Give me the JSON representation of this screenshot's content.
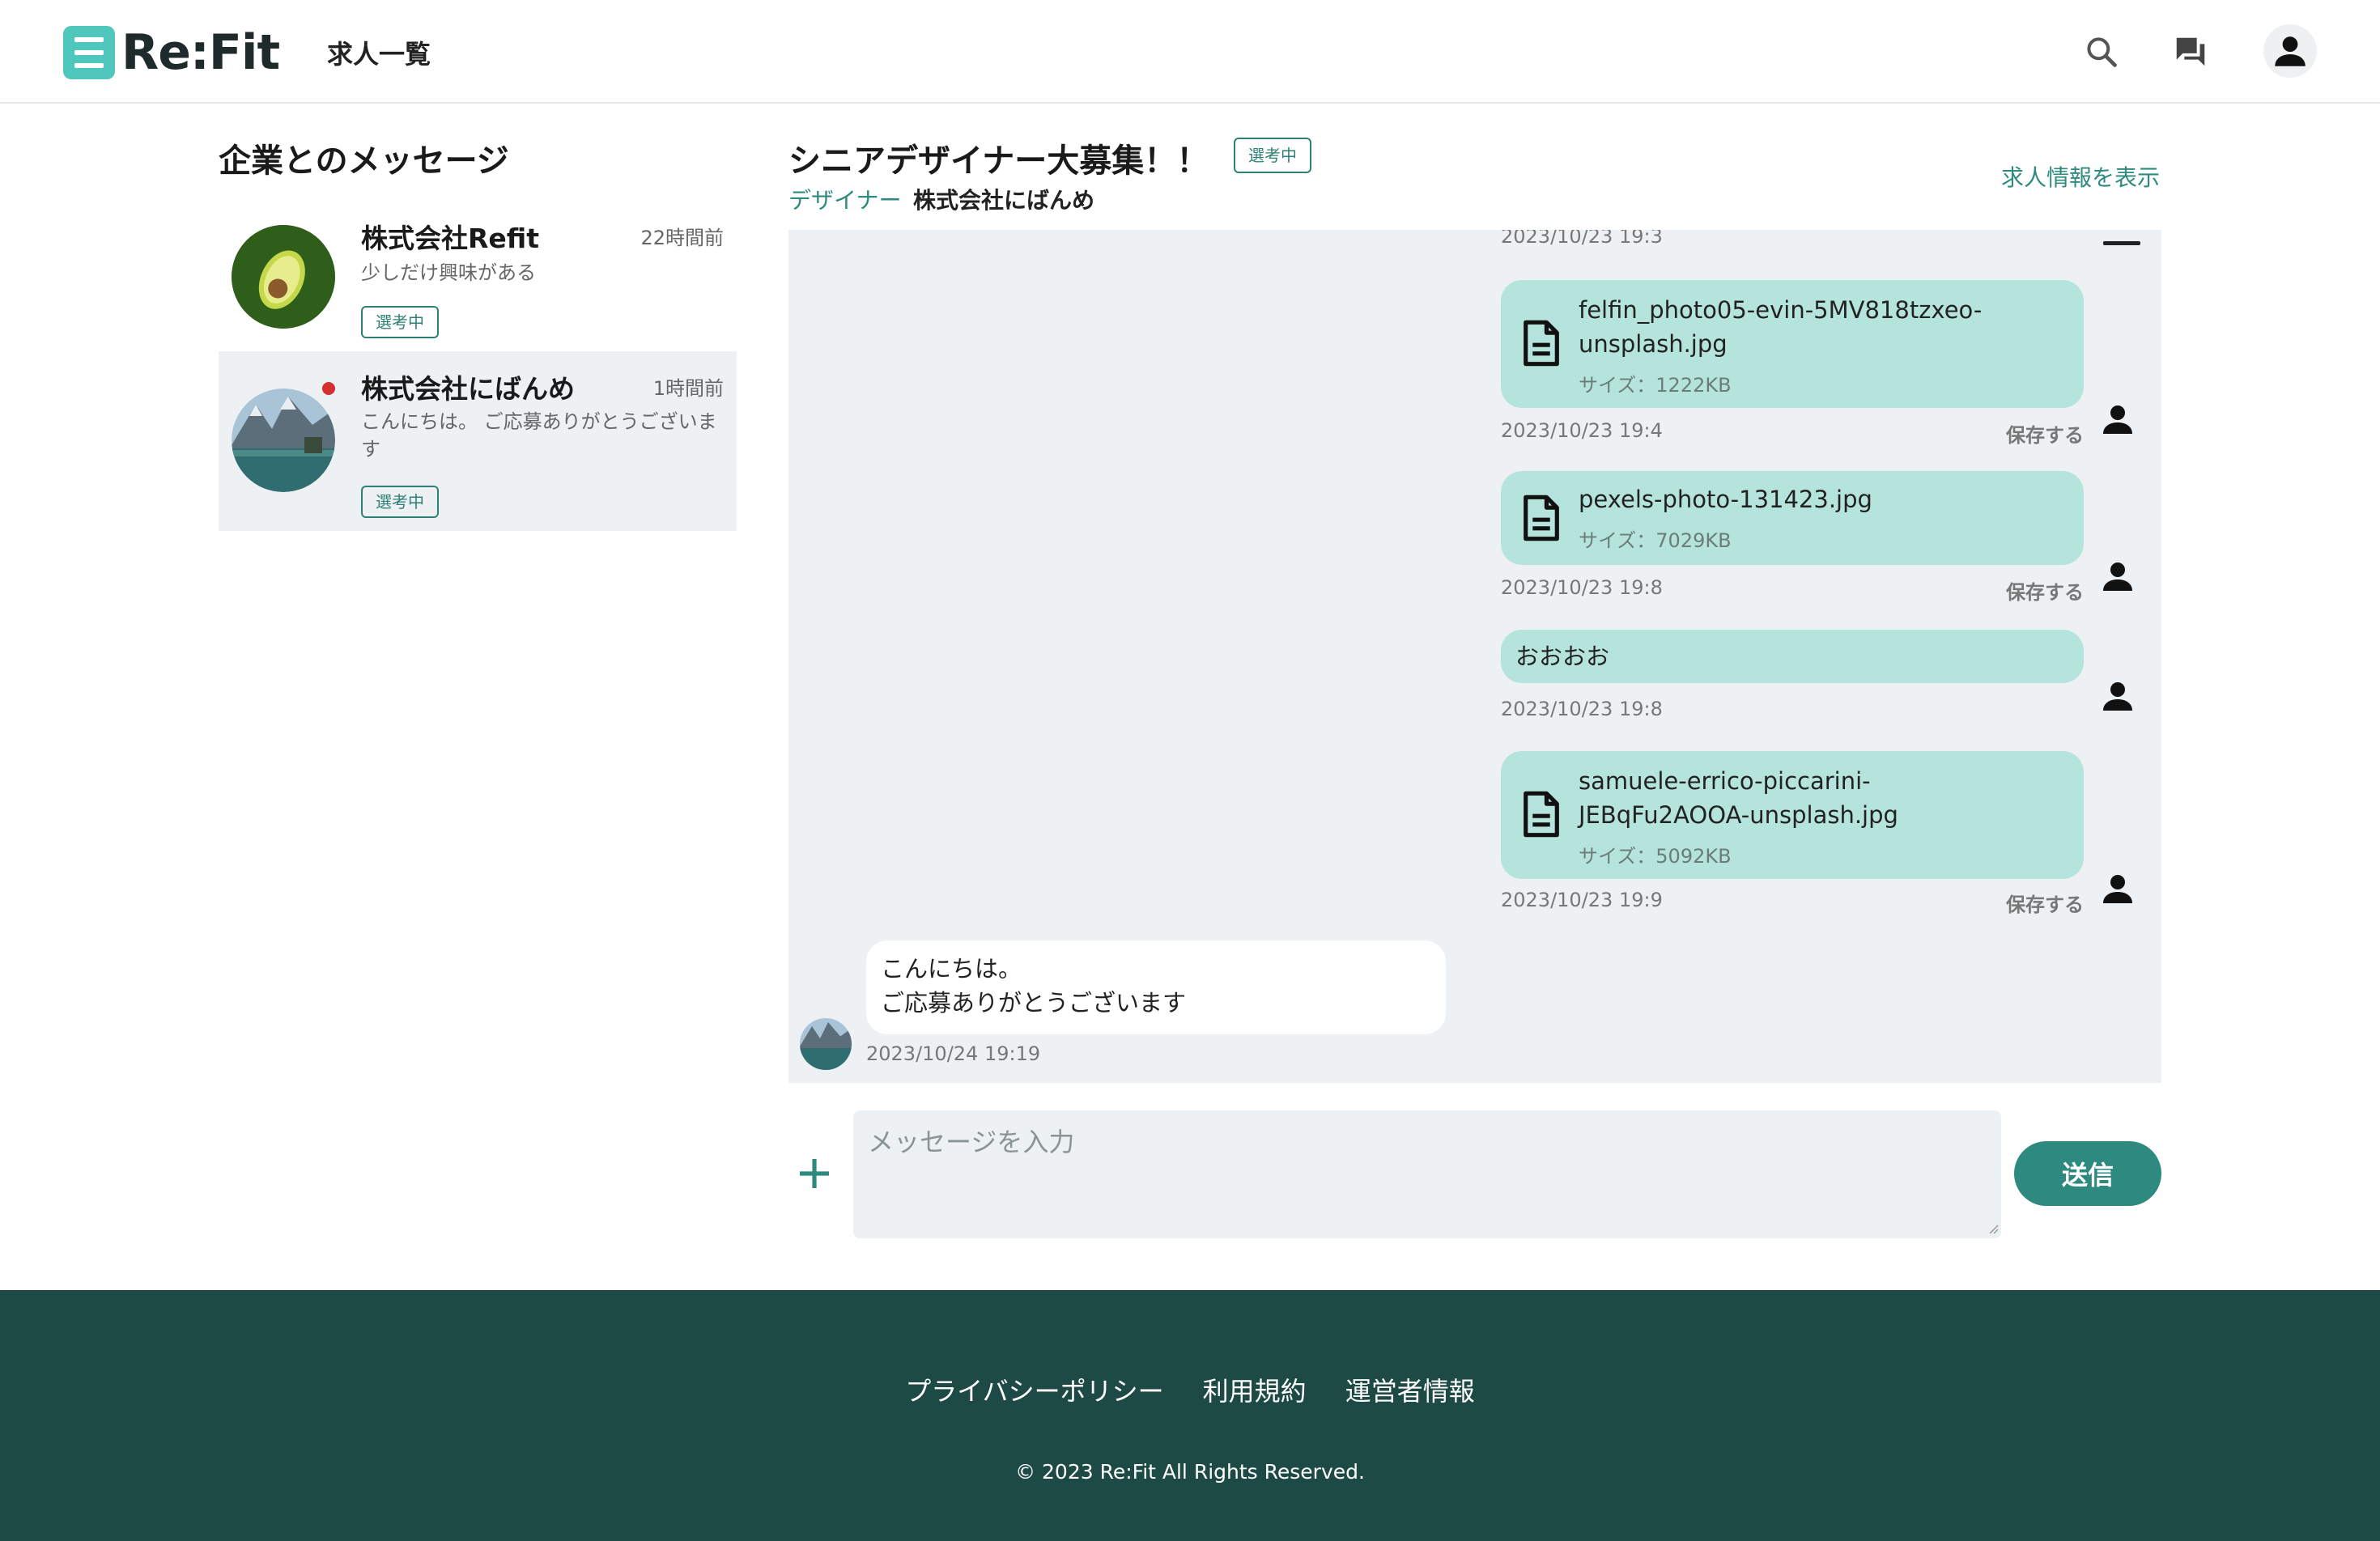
{
  "header": {
    "logo_text": "Re:Fit",
    "nav_jobs": "求人一覧",
    "icons": [
      "search-icon",
      "chat-icon",
      "account-icon"
    ]
  },
  "sidebar": {
    "title": "企業とのメッセージ",
    "conversations": [
      {
        "company": "株式会社Refit",
        "time": "22時間前",
        "preview": "少しだけ興味がある",
        "status": "選考中",
        "unread": false,
        "active": false
      },
      {
        "company": "株式会社にばんめ",
        "time": "1時間前",
        "preview": "こんにちは。 ご応募ありがとうございます",
        "status": "選考中",
        "unread": true,
        "active": true
      }
    ]
  },
  "chat_header": {
    "job_title": "シニアデザイナー大募集！！",
    "status": "選考中",
    "category": "デザイナー",
    "company": "株式会社にばんめ",
    "view_job_link": "求人情報を表示"
  },
  "messages": {
    "cut_time": "2023/10/23 19:3",
    "items": [
      {
        "type": "file",
        "name": "felfin_photo05-evin-5MV818tzxeo-unsplash.jpg",
        "size": "サイズ：1222KB",
        "time": "2023/10/23 19:4",
        "save": "保存する"
      },
      {
        "type": "file",
        "name": "pexels-photo-131423.jpg",
        "size": "サイズ：7029KB",
        "time": "2023/10/23 19:8",
        "save": "保存する"
      },
      {
        "type": "text",
        "text": "おおおお",
        "time": "2023/10/23 19:8"
      },
      {
        "type": "file",
        "name": "samuele-errico-piccarini-JEBqFu2AOOA-unsplash.jpg",
        "size": "サイズ：5092KB",
        "time": "2023/10/23 19:9",
        "save": "保存する"
      },
      {
        "type": "incoming",
        "line1": "こんにちは。",
        "line2": "ご応募ありがとうございます",
        "time": "2023/10/24 19:19"
      }
    ]
  },
  "composer": {
    "placeholder": "メッセージを入力",
    "send_label": "送信"
  },
  "footer": {
    "links": [
      "プライバシーポリシー",
      "利用規約",
      "運営者情報"
    ],
    "copyright": "© 2023 Re:Fit All Rights Reserved."
  },
  "colors": {
    "accent": "#2e8a7f",
    "bubble": "#b5e4dd",
    "footer_bg": "#1e4a45",
    "logo": "#4fc7bd"
  }
}
